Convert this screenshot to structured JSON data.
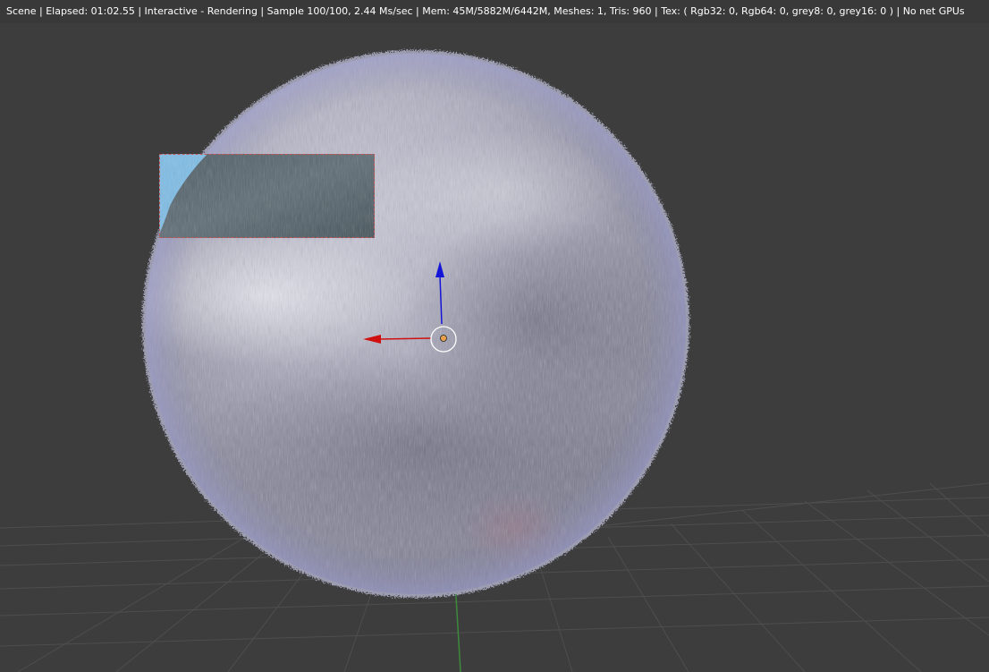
{
  "header": {
    "status_text": "Scene | Elapsed: 01:02.55 | Interactive - Rendering | Sample 100/100, 2.44 Ms/sec | Mem: 45M/5882M/6442M, Meshes: 1, Tris: 960 | Tex: ( Rgb32: 0, Rgb64: 0, grey8: 0, grey16: 0 ) | No net GPUs"
  },
  "colors": {
    "viewport_background": "#3d3d3d",
    "grid_line": "#4d4d4d",
    "axis_y": "#3d8a3d",
    "axis_x": "#d01010",
    "axis_z": "#1515d8",
    "object_origin": "#e8a04a",
    "border_region": "#c45656",
    "sky_preview": "#7fbde6"
  },
  "icons": {
    "manipulator": "transform-manipulator-icon",
    "origin": "object-origin-icon"
  }
}
